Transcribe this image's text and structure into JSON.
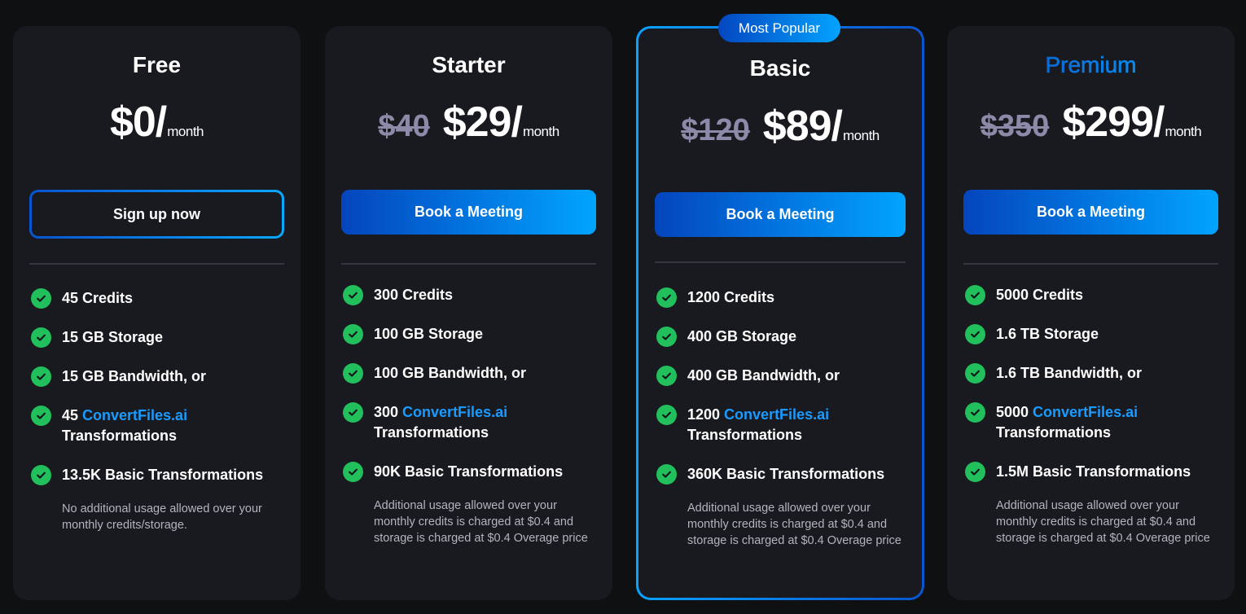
{
  "badge": "Most Popular",
  "colors": {
    "page_bg": "#0f1012",
    "card_bg": "#181a20",
    "check_green": "#22c05c",
    "brand_blue": "#1a9bff",
    "gradient_dark": "#0445bd",
    "gradient_light": "#01a4ff",
    "old_price": "#8b8aa8"
  },
  "plans": [
    {
      "name": "Free",
      "old_price": "",
      "price": "$0/",
      "period": "month",
      "button": "Sign up now",
      "features": [
        {
          "prefix": "45 Credits",
          "brand": "",
          "suffix": ""
        },
        {
          "prefix": "15 GB Storage",
          "brand": "",
          "suffix": ""
        },
        {
          "prefix": "15 GB Bandwidth, or",
          "brand": "",
          "suffix": ""
        },
        {
          "prefix": "45 ",
          "brand": "ConvertFiles.ai",
          "suffix": "Transformations"
        },
        {
          "prefix": "13.5K Basic Transformations",
          "brand": "",
          "suffix": ""
        }
      ],
      "note": "No additional usage allowed over your monthly credits/storage."
    },
    {
      "name": "Starter",
      "old_price": "$40",
      "price": "$29/",
      "period": "month",
      "button": "Book a Meeting",
      "features": [
        {
          "prefix": "300 Credits",
          "brand": "",
          "suffix": ""
        },
        {
          "prefix": "100 GB Storage",
          "brand": "",
          "suffix": ""
        },
        {
          "prefix": "100 GB Bandwidth, or",
          "brand": "",
          "suffix": ""
        },
        {
          "prefix": "300 ",
          "brand": "ConvertFiles.ai",
          "suffix": "Transformations"
        },
        {
          "prefix": "90K Basic Transformations",
          "brand": "",
          "suffix": ""
        }
      ],
      "note": "Additional usage allowed over your monthly credits is charged at $0.4 and storage is charged at $0.4 Overage price"
    },
    {
      "name": "Basic",
      "old_price": "$120",
      "price": "$89/",
      "period": "month",
      "button": "Book a Meeting",
      "features": [
        {
          "prefix": "1200 Credits",
          "brand": "",
          "suffix": ""
        },
        {
          "prefix": "400 GB Storage",
          "brand": "",
          "suffix": ""
        },
        {
          "prefix": "400 GB Bandwidth, or",
          "brand": "",
          "suffix": ""
        },
        {
          "prefix": "1200 ",
          "brand": "ConvertFiles.ai",
          "suffix": "Transformations"
        },
        {
          "prefix": "360K Basic Transformations",
          "brand": "",
          "suffix": ""
        }
      ],
      "note": "Additional usage allowed over your monthly credits is charged at $0.4 and storage is charged at $0.4 Overage price"
    },
    {
      "name": "Premium",
      "old_price": "$350",
      "price": "$299/",
      "period": "month",
      "button": "Book a Meeting",
      "features": [
        {
          "prefix": "5000 Credits",
          "brand": "",
          "suffix": ""
        },
        {
          "prefix": "1.6 TB Storage",
          "brand": "",
          "suffix": ""
        },
        {
          "prefix": "1.6 TB Bandwidth, or",
          "brand": "",
          "suffix": ""
        },
        {
          "prefix": "5000 ",
          "brand": "ConvertFiles.ai",
          "suffix": "Transformations"
        },
        {
          "prefix": "1.5M Basic Transformations",
          "brand": "",
          "suffix": ""
        }
      ],
      "note": "Additional usage allowed over your monthly credits is charged at $0.4 and storage is charged at $0.4 Overage price"
    }
  ]
}
